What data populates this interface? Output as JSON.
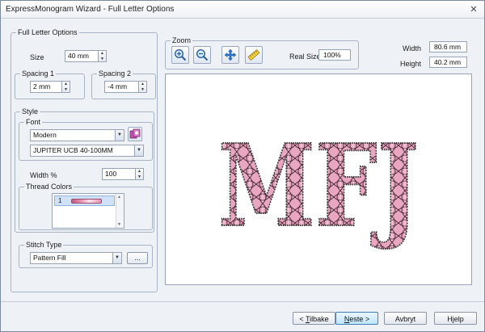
{
  "window": {
    "title": "ExpressMonogram Wizard - Full Letter Options",
    "close_glyph": "✕"
  },
  "full_letter_options": {
    "legend": "Full Letter Options",
    "size": {
      "label": "Size",
      "value": "40 mm"
    },
    "spacing1": {
      "legend": "Spacing 1",
      "value": "2 mm"
    },
    "spacing2": {
      "legend": "Spacing 2",
      "value": "-4 mm"
    }
  },
  "style": {
    "legend": "Style",
    "font": {
      "legend": "Font",
      "family": "Modern",
      "font_name": "JUPITER UCB 40-100MM"
    },
    "width": {
      "label": "Width %",
      "value": "100"
    },
    "thread_colors": {
      "legend": "Thread Colors",
      "items": [
        {
          "number": "1",
          "color": "#e98fb0"
        }
      ]
    },
    "stitch_type": {
      "legend": "Stitch Type",
      "value": "Pattern Fill",
      "ellipsis_label": "..."
    }
  },
  "zoom": {
    "legend": "Zoom",
    "buttons": [
      "zoom-in-icon",
      "zoom-out-icon",
      "pan-icon",
      "real-size-icon"
    ],
    "real_size_label": "Real Size",
    "real_size_value": "100%"
  },
  "dimensions": {
    "width_label": "Width",
    "width_value": "80.6 mm",
    "height_label": "Height",
    "height_value": "40.2 mm"
  },
  "preview": {
    "monogram": "MFJ",
    "colors": {
      "fill": "#e9a6c0",
      "stroke": "#3a3a3a",
      "pattern_line": "#4a2a36"
    }
  },
  "footer": {
    "back": {
      "prefix": "< ",
      "mnemonic": "T",
      "rest": "ilbake"
    },
    "next": {
      "mnemonic": "N",
      "rest": "este >"
    },
    "cancel": "Avbryt",
    "help": "Hjelp"
  },
  "colors": {
    "accent": "#3c7fb1",
    "window_bg": "#eef1f6",
    "group_border": "#a8b4c6"
  }
}
